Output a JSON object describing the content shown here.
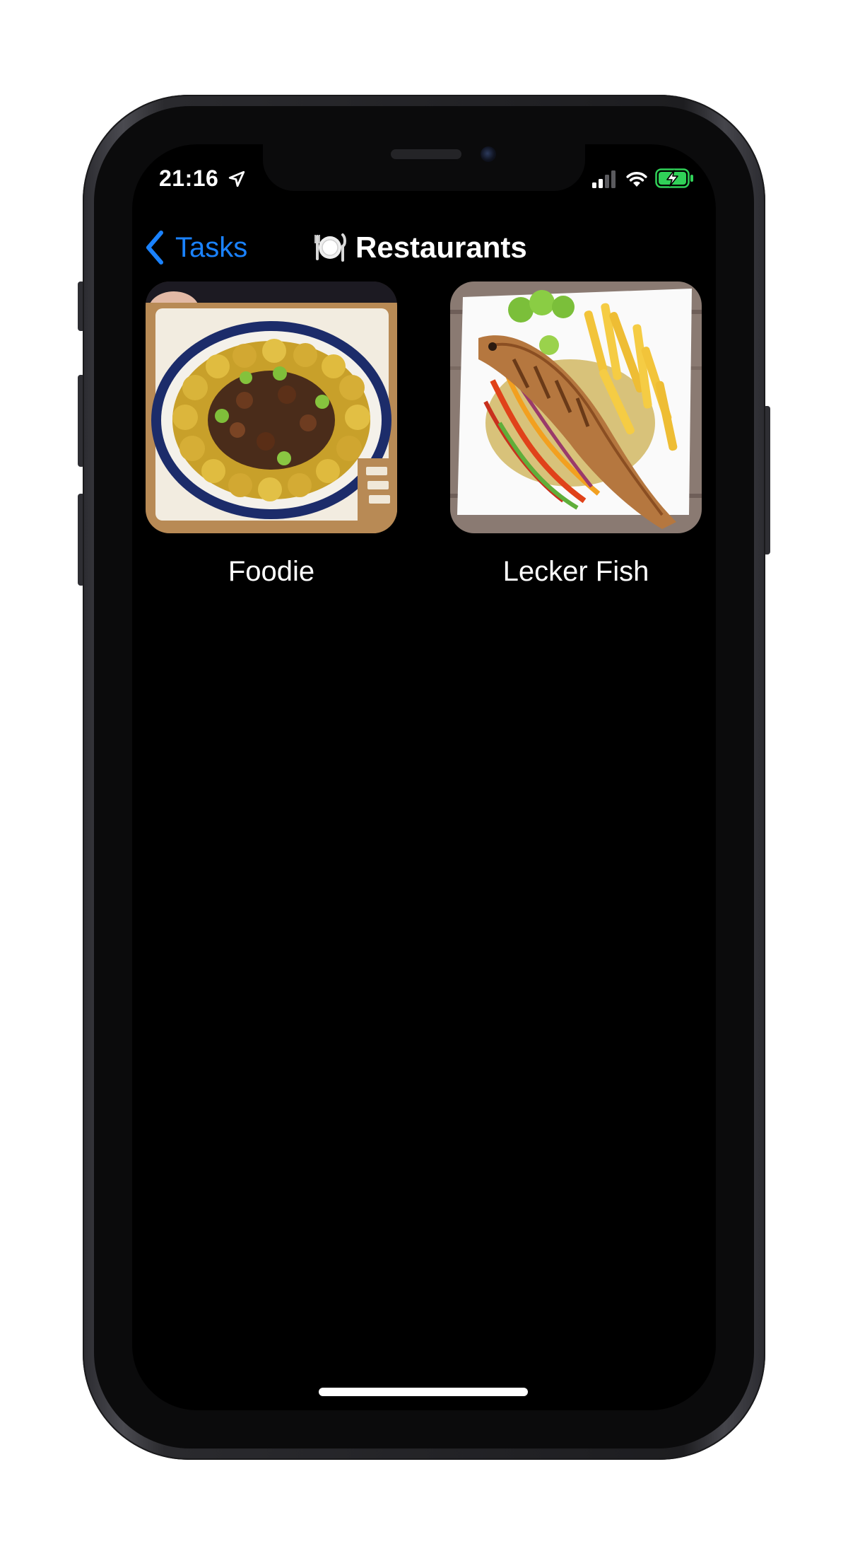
{
  "status_bar": {
    "time": "21:16",
    "location_icon": "location-arrow-icon",
    "signal_icon": "cellular-signal-icon",
    "wifi_icon": "wifi-icon",
    "battery_icon": "battery-charging-icon",
    "battery_color": "#30d158"
  },
  "navigation": {
    "back_label": "Tasks",
    "back_icon": "chevron-left-icon",
    "title_icon": "plate-with-cutlery-icon",
    "title": "Restaurants",
    "accent_color": "#1a82ff"
  },
  "items": [
    {
      "label": "Foodie",
      "image": "platter-of-fried-plantains-and-meat-photo"
    },
    {
      "label": "Lecker Fish",
      "image": "grilled-fish-with-fries-photo"
    }
  ]
}
